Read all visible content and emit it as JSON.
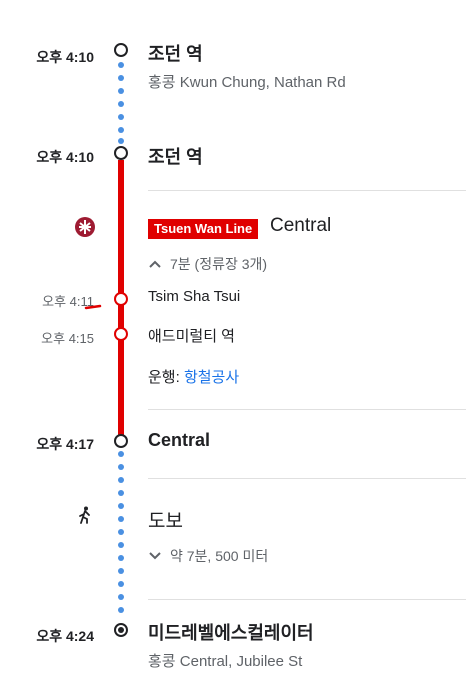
{
  "stops": [
    {
      "time": "오후 4:10",
      "name": "조던 역",
      "address": "홍콩 Kwun Chung, Nathan Rd"
    },
    {
      "time": "오후 4:10",
      "name": "조던 역"
    },
    {
      "time": "오후 4:17",
      "name": "Central"
    },
    {
      "time": "오후 4:24",
      "name": "미드레벨에스컬레이터",
      "address": "홍콩 Central, Jubilee St"
    }
  ],
  "transit": {
    "line_name": "Tsuen Wan Line",
    "line_color": "#e00000",
    "destination": "Central",
    "duration": "7분 (정류장 3개)",
    "expand_icon": "chevron-up-icon",
    "intermediate": [
      {
        "time": "오후 4:11",
        "name": "Tsim Sha Tsui"
      },
      {
        "time": "오후 4:15",
        "name": "애드미럴티 역"
      }
    ],
    "operator_label": "운행:",
    "operator_name": "항철공사",
    "mode_icon": "mtr-logo-icon"
  },
  "walk": {
    "label": "도보",
    "details": "약 7분, 500 미터",
    "icon": "walking-person-icon",
    "expand_icon": "chevron-down-icon"
  },
  "colors": {
    "walk_dots": "#4a90e2",
    "link": "#1a73e8"
  }
}
